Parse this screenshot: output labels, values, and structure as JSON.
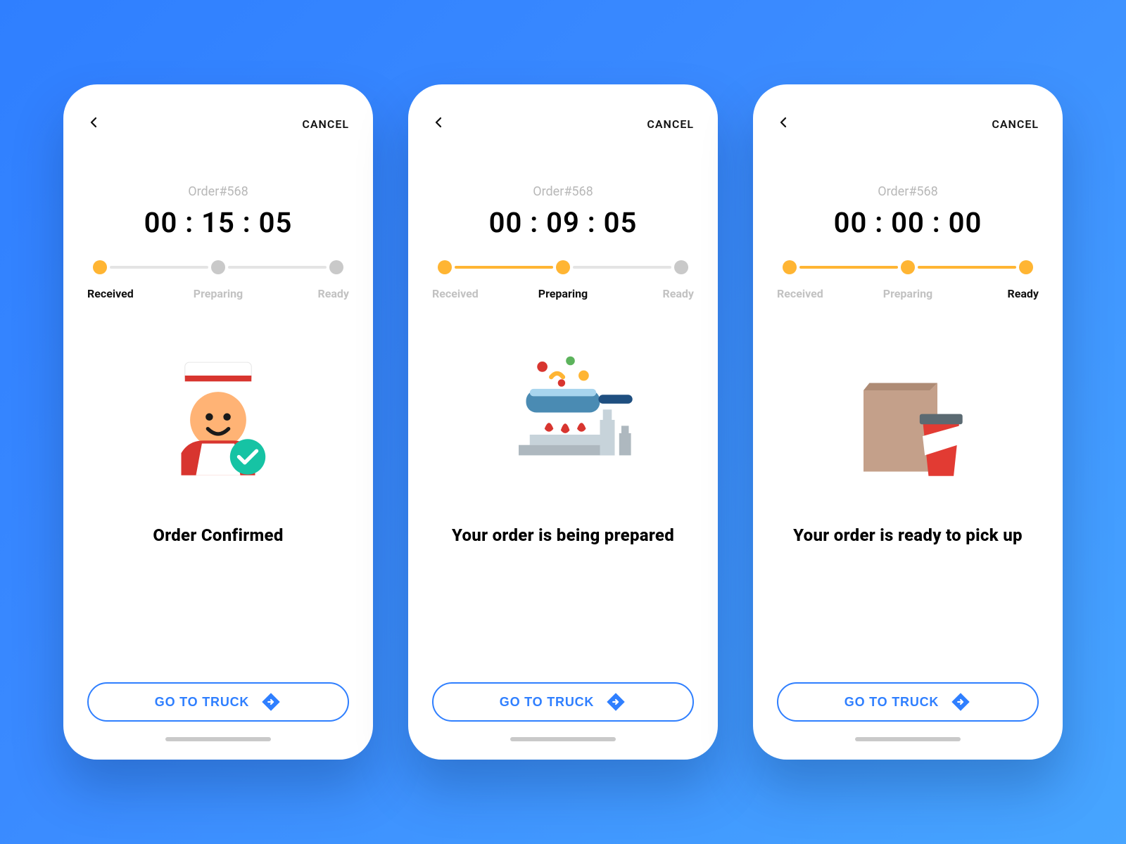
{
  "shared": {
    "order_label": "Order#568",
    "cancel_label": "CANCEL",
    "steps": {
      "received": "Received",
      "preparing": "Preparing",
      "ready": "Ready"
    },
    "cta_label": "GO TO TRUCK"
  },
  "screens": [
    {
      "timer": "00 : 15 : 05",
      "title": "Order Confirmed",
      "active_step": "received",
      "dots": [
        "active",
        "inactive",
        "inactive"
      ],
      "bars": [
        "inactive",
        "inactive"
      ],
      "illustration": "chef-icon"
    },
    {
      "timer": "00 : 09 : 05",
      "title": "Your order is being prepared",
      "active_step": "preparing",
      "dots": [
        "active",
        "active",
        "inactive"
      ],
      "bars": [
        "active",
        "inactive"
      ],
      "illustration": "cooking-icon"
    },
    {
      "timer": "00 : 00 : 00",
      "title": "Your order is ready to pick up",
      "active_step": "ready",
      "dots": [
        "active",
        "active",
        "active"
      ],
      "bars": [
        "active",
        "active"
      ],
      "illustration": "bag-cup-icon"
    }
  ],
  "colors": {
    "accent": "#2f7fff",
    "step_active": "#ffb533"
  }
}
